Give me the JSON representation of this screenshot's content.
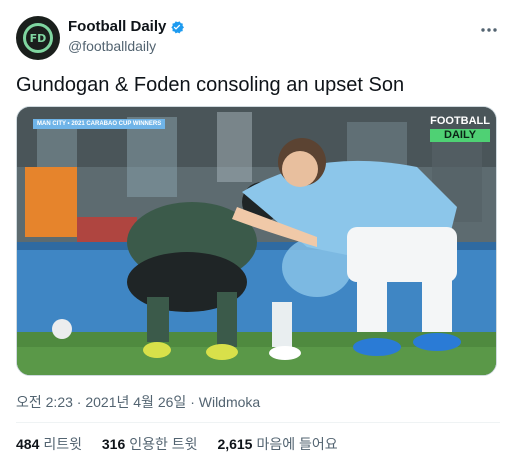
{
  "author": {
    "display_name": "Football Daily",
    "handle": "@footballdaily",
    "avatar_text": "FD",
    "verified": true
  },
  "tweet": {
    "text": "Gundogan & Foden consoling an upset Son"
  },
  "media": {
    "caption": "MAN CITY • 2021 CARABAO CUP WINNERS",
    "watermark_line1": "FOOTBALL",
    "watermark_line2": "DAILY"
  },
  "meta": {
    "time": "오전 2:23",
    "separator": "·",
    "date": "2021년 4월 26일",
    "source": "Wildmoka"
  },
  "stats": {
    "retweets_count": "484",
    "retweets_label": "리트윗",
    "quotes_count": "316",
    "quotes_label": "인용한 트윗",
    "likes_count": "2,615",
    "likes_label": "마음에 들어요"
  },
  "colors": {
    "brand_green": "#4fd174",
    "verified_blue": "#1d9bf0",
    "city_blue": "#8cc6ea",
    "spurs_green": "#3b5a4a"
  }
}
